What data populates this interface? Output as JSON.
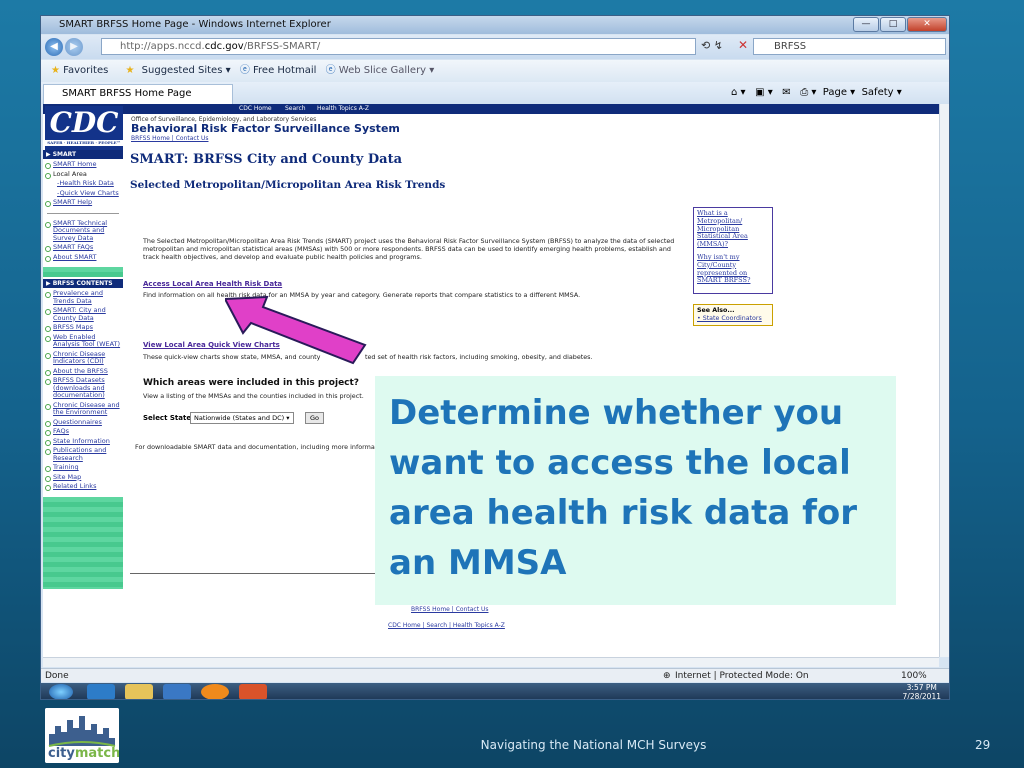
{
  "window": {
    "title": "SMART BRFSS Home Page - Windows Internet Explorer",
    "url_prefix": "http://apps.nccd.",
    "url_domain": "cdc.gov",
    "url_path": "/BRFSS-SMART/",
    "search_placeholder": "BRFSS",
    "favorites_label": "Favorites",
    "suggested_sites": "Suggested Sites ▾",
    "free_hotmail": "Free Hotmail",
    "web_slice": "Web Slice Gallery ▾",
    "tab_title": "SMART BRFSS Home Page",
    "page_menu": "Page ▾",
    "safety_menu": "Safety ▾",
    "status_left": "Done",
    "status_zone": "Internet | Protected Mode: On",
    "zoom": "100%",
    "clock_time": "3:57 PM",
    "clock_date": "7/28/2011"
  },
  "page": {
    "topnav": [
      "CDC Home",
      "Search",
      "Health Topics A-Z"
    ],
    "logo_text": "CDC",
    "logo_tag": "SAFER · HEALTHIER · PEOPLE™",
    "header_sub": "Office of Surveillance, Epidemiology, and Laboratory Services",
    "header_title": "Behavioral Risk Factor Surveillance System",
    "header_links": "BRFSS Home | Contact Us",
    "h1": "SMART: BRFSS City and County Data",
    "h2": "Selected Metropolitan/Micropolitan Area Risk Trends",
    "intro": "The Selected Metropolitan/Micropolitan Area Risk Trends (SMART) project uses the Behavioral Risk Factor Surveillance System (BRFSS) to analyze the data of selected metropolitan and micropolitan statistical areas (MMSAs) with 500 or more respondents. BRFSS data can be used to identify emerging health problems, establish and track health objectives, and develop and evaluate public health policies and programs.",
    "link1": "Access Local Area Health Risk Data",
    "link1_desc": "Find information on all health risk data for an MMSA by year and category. Generate reports that compare statistics to a different MMSA.",
    "link2": "View Local Area Quick View Charts",
    "link2_desc": "These quick-view charts show state, MMSA, and county",
    "link2_desc_tail": "ted set of health risk factors, including smoking, obesity, and diabetes.",
    "areas_heading": "Which areas were included in this project?",
    "areas_desc": "View a listing of the MMSAs and the counties included in this project.",
    "select_label": "Select State:",
    "select_value": "Nationwide (States and DC)",
    "go_label": "Go",
    "download_text": "For downloadable SMART data and documentation, including more informa",
    "footer_links1": "BRFSS Home | Contact Us",
    "footer_links2": "CDC Home | Search | Health Topics A-Z",
    "box1_items": [
      "What is a Metropolitan/ Micropolitan Statistical Area (MMSA)?",
      "Why isn't my City/County represented on SMART BRFSS?"
    ],
    "box2_title": "See Also...",
    "box2_item": "• State Coordinators",
    "sidebar_smart_header": "▶ SMART",
    "sidebar_smart": [
      {
        "label": "SMART Home",
        "kind": "link"
      },
      {
        "label": "Local Area",
        "kind": "plain"
      },
      {
        "label": "-Health Risk Data",
        "kind": "sub"
      },
      {
        "label": "-Quick View Charts",
        "kind": "sub"
      },
      {
        "label": "SMART Help",
        "kind": "link"
      }
    ],
    "sidebar_smart2": [
      "SMART Technical Documents and Survey Data",
      "SMART FAQs",
      "About SMART"
    ],
    "sidebar_brfss_header": "▶ BRFSS CONTENTS",
    "sidebar_brfss": [
      "Prevalence and Trends Data",
      "SMART: City and County Data",
      "BRFSS Maps",
      "Web Enabled Analysis Tool (WEAT)",
      "Chronic Disease Indicators (CDI)",
      "About the BRFSS",
      "BRFSS Datasets (downloads and documentation)",
      "Chronic Disease and the Environment",
      "Questionnaires",
      "FAQs",
      "State Information",
      "Publications and Research",
      "Training",
      "Site Map",
      "Related Links"
    ]
  },
  "overlay": {
    "text": "Determine whether you want to access the local area health risk data for an MMSA"
  },
  "slide": {
    "footer": "Navigating the National MCH Surveys",
    "page_number": "29",
    "logo_word_a": "city",
    "logo_word_b": "match"
  },
  "colors": {
    "overlay_text": "#1e74b8",
    "overlay_bg": "#defaf0",
    "arrow_fill": "#e040c8",
    "cdc_blue": "#0f2b7a"
  }
}
